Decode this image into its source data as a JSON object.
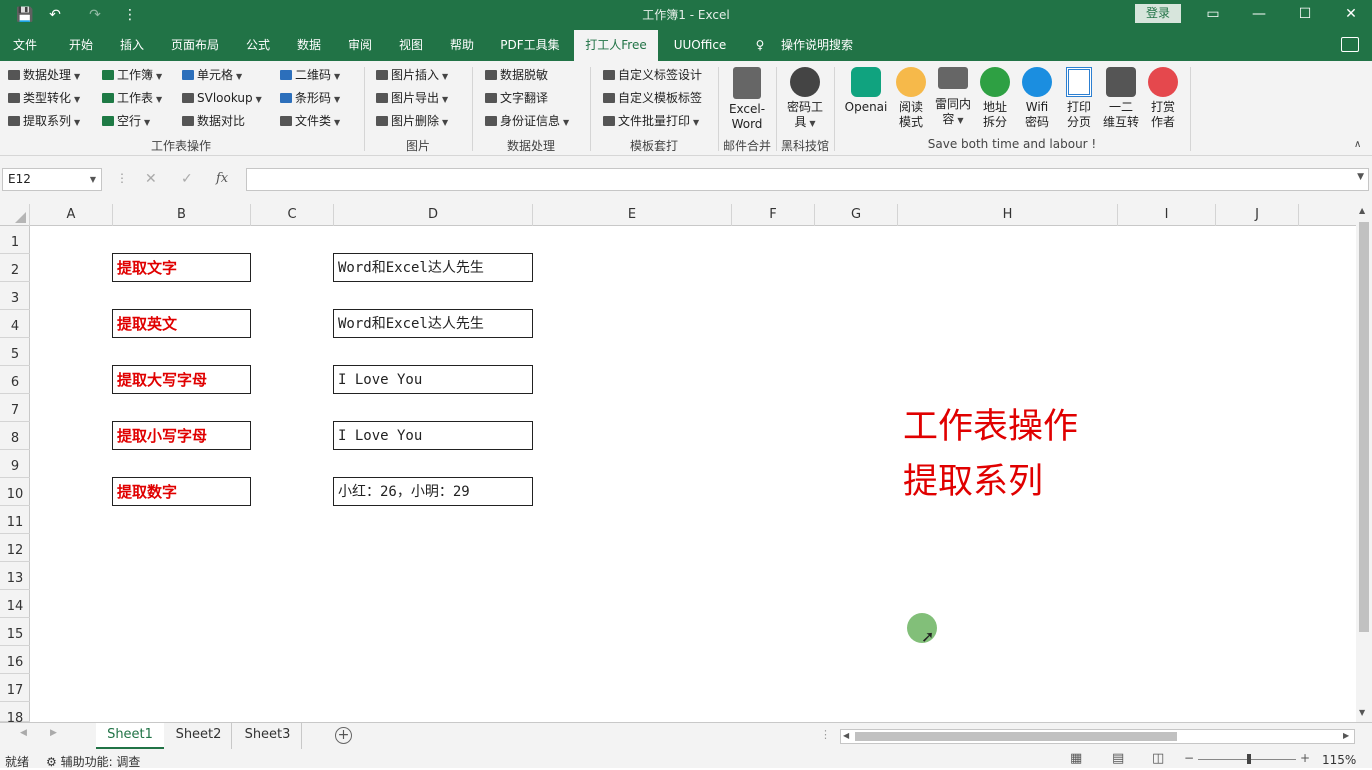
{
  "titlebar": {
    "title": "工作簿1  -  Excel",
    "login": "登录",
    "qat_save": "💾",
    "qat_undo": "↶",
    "qat_redo": "↷",
    "qat_customize": "⋮"
  },
  "tabs": [
    "文件",
    "开始",
    "插入",
    "页面布局",
    "公式",
    "数据",
    "审阅",
    "视图",
    "帮助",
    "PDF工具集",
    "打工人Free",
    "UUOffice",
    "操作说明搜索"
  ],
  "ribbon": {
    "group1": {
      "items": [
        "数据处理",
        "类型转化",
        "提取系列",
        "工作簿",
        "工作表",
        "空行",
        "单元格",
        "SVlookup",
        "数据对比",
        "二维码",
        "条形码",
        "文件类"
      ],
      "name": "工作表操作"
    },
    "group2": {
      "items": [
        "图片插入",
        "图片导出",
        "图片删除"
      ],
      "name": "图片"
    },
    "group3": {
      "items": [
        "数据脱敏",
        "文字翻译",
        "身份证信息"
      ],
      "name": "数据处理"
    },
    "group4": {
      "items": [
        "自定义标签设计",
        "自定义模板标签",
        "文件批量打印"
      ],
      "name": "模板套打"
    },
    "group5": {
      "label1": "Excel-",
      "label2": "Word",
      "name": "邮件合并"
    },
    "group6": {
      "label1": "密码工",
      "label2": "具",
      "name": "黑科技馆"
    },
    "group7": {
      "buttons": [
        {
          "l1": "Openai",
          "l2": ""
        },
        {
          "l1": "阅读",
          "l2": "模式"
        },
        {
          "l1": "雷同内",
          "l2": "容"
        },
        {
          "l1": "地址",
          "l2": "拆分"
        },
        {
          "l1": "Wifi",
          "l2": "密码"
        },
        {
          "l1": "打印",
          "l2": "分页"
        },
        {
          "l1": "一二",
          "l2": "维互转"
        },
        {
          "l1": "打赏",
          "l2": "作者"
        }
      ],
      "name": "Save both time and labour !"
    }
  },
  "formula_bar": {
    "name_box": "E12",
    "cancel": "✕",
    "enter": "✓",
    "fx": "fx",
    "value": ""
  },
  "columns": [
    "A",
    "B",
    "C",
    "D",
    "E",
    "F",
    "G",
    "H",
    "I",
    "J"
  ],
  "rows": [
    "1",
    "2",
    "3",
    "4",
    "5",
    "6",
    "7",
    "8",
    "9",
    "10",
    "11",
    "12",
    "13",
    "14",
    "15",
    "16",
    "17",
    "18"
  ],
  "cells": {
    "b2": "提取文字",
    "d2": "Word和Excel达人先生",
    "b4": "提取英文",
    "d4": "Word和Excel达人先生",
    "b6": "提取大写字母",
    "d6": "I Love You",
    "b8": "提取小写字母",
    "d8": "I Love You",
    "b10": "提取数字",
    "d10": "小红：26，小明：29"
  },
  "overlay_text": {
    "line1": "工作表操作",
    "line2": "提取系列"
  },
  "sheets": [
    "Sheet1",
    "Sheet2",
    "Sheet3"
  ],
  "status": {
    "ready": "就绪",
    "accessibility": "辅助功能: 调查",
    "zoom": "115%"
  },
  "colors": {
    "accent": "#217346",
    "red_text": "#e00000"
  }
}
